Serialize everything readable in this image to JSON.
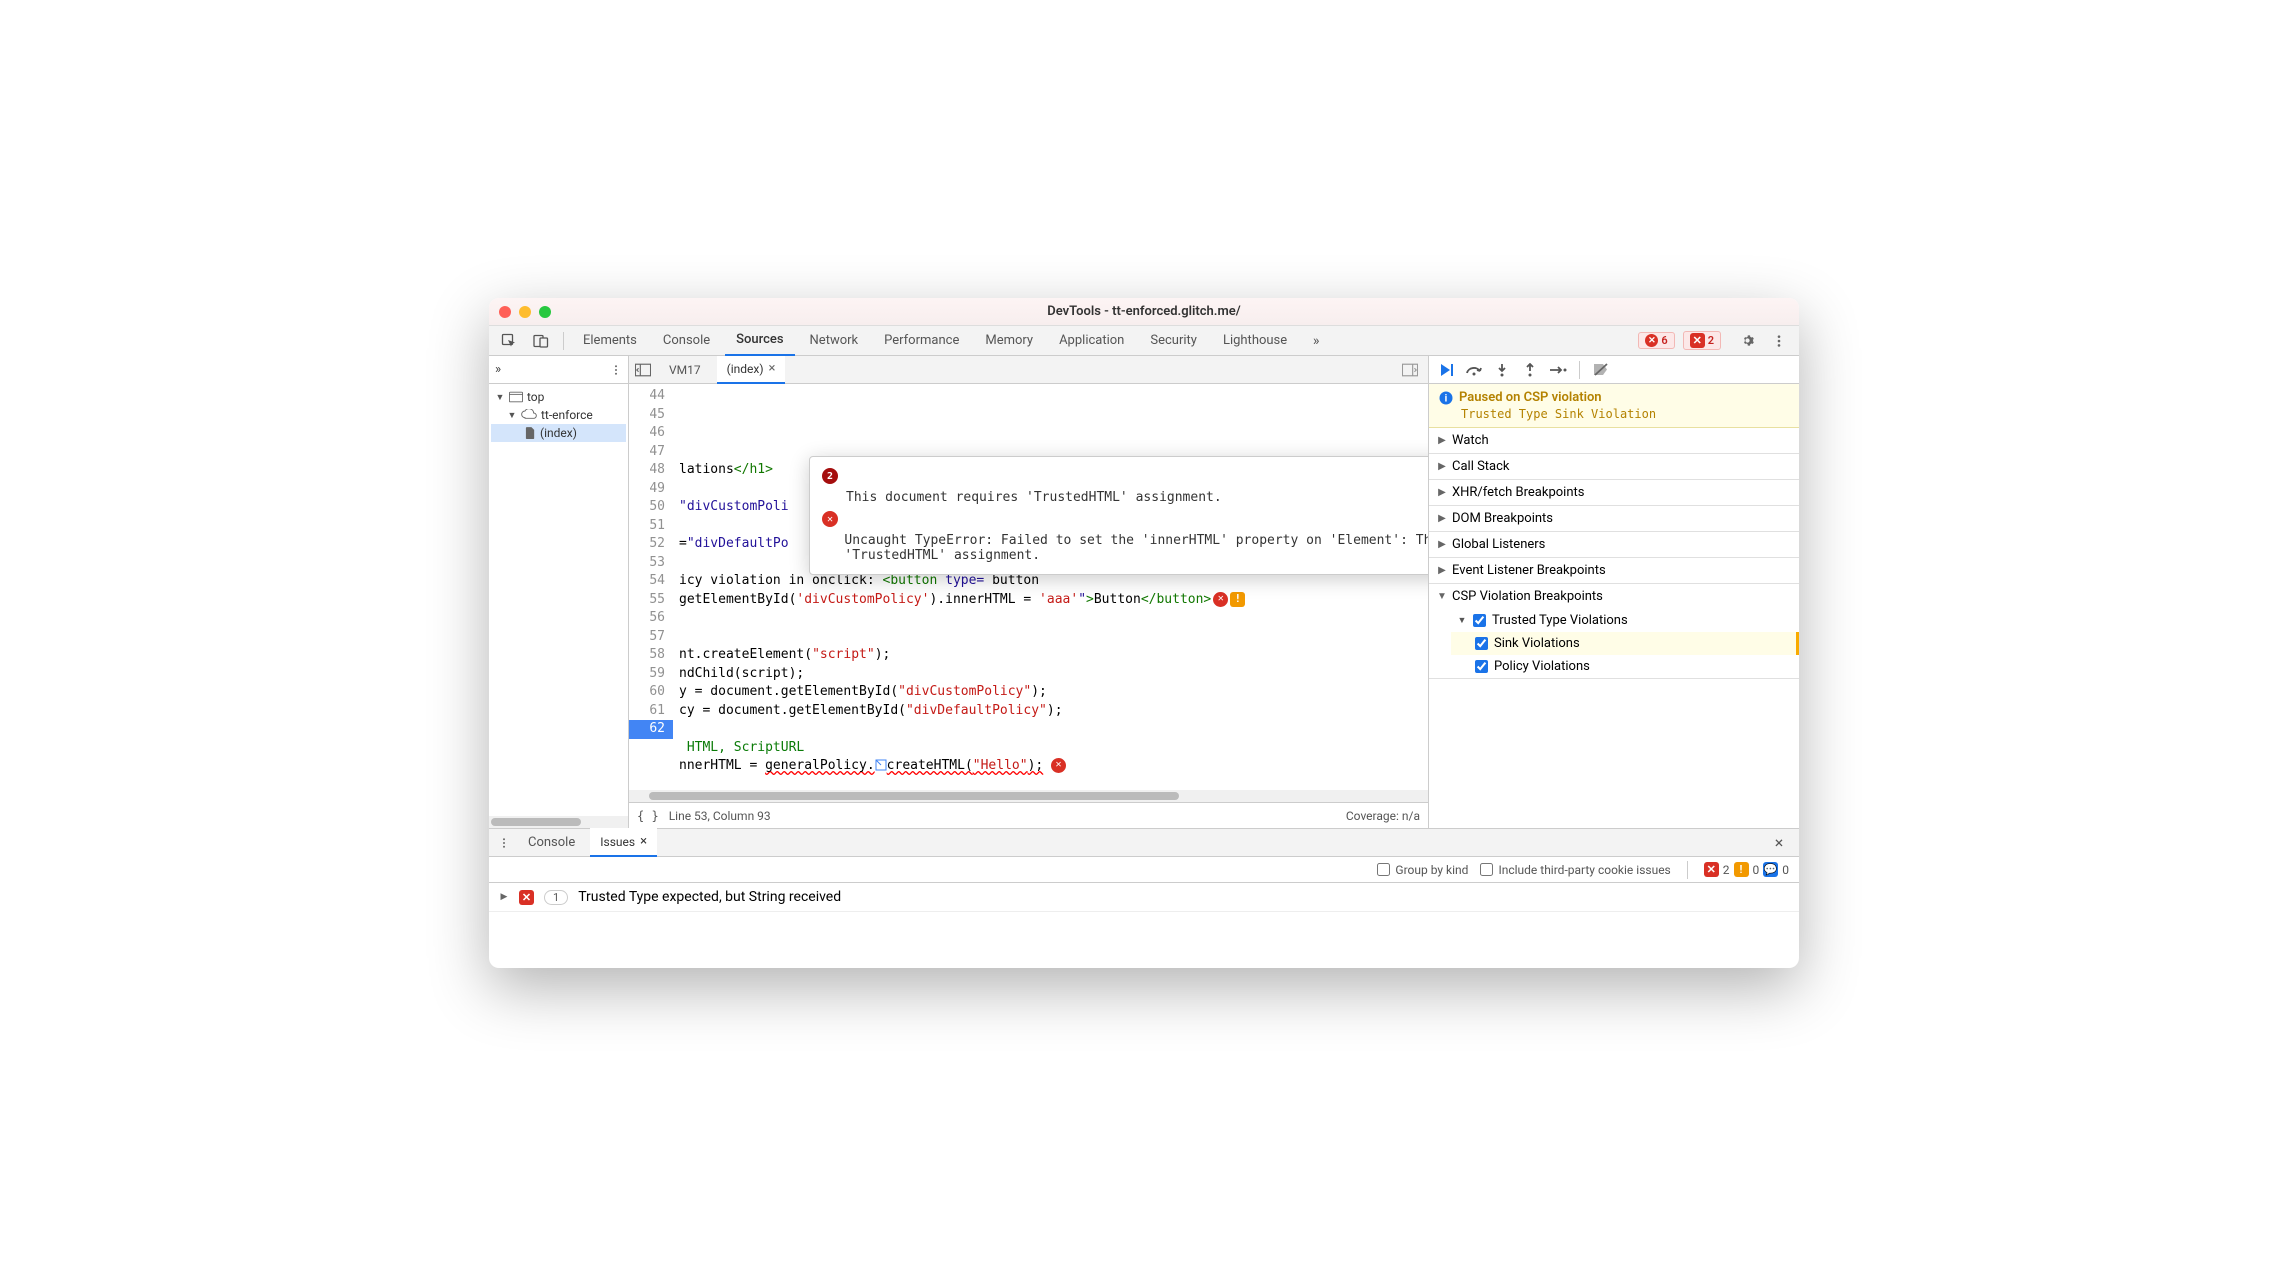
{
  "window": {
    "title": "DevTools - tt-enforced.glitch.me/"
  },
  "tabs": [
    "Elements",
    "Console",
    "Sources",
    "Network",
    "Performance",
    "Memory",
    "Application",
    "Security",
    "Lighthouse"
  ],
  "activeTab": "Sources",
  "errorBadges": {
    "errors": 6,
    "issues": 2
  },
  "leftTree": {
    "top": "top",
    "origin": "tt-enforce",
    "file": "(index)"
  },
  "fileTabs": {
    "vm": "VM17",
    "index": "(index)"
  },
  "gutterStart": 44,
  "code": {
    "l46": "lations</h1>",
    "l48": "\"divCustomPoli",
    "l50": "=\"divDefaultPo",
    "l52": "icy violation in onclick: <button type= button",
    "l53": "getElementById('divCustomPolicy').innerHTML = 'aaa'\">Button</button>",
    "l56": "nt.createElement(\"script\");",
    "l57": "ndChild(script);",
    "l58": "y = document.getElementById(\"divCustomPolicy\");",
    "l59": "cy = document.getElementById(\"divDefaultPolicy\");",
    "l61": " HTML, ScriptURL",
    "l62": "nnerHTML = generalPolicy.createHTML(\"Hello\");"
  },
  "tooltip": {
    "count": "2",
    "msg1": "This document requires 'TrustedHTML' assignment.",
    "msg2": "Uncaught TypeError: Failed to set the 'innerHTML' property on 'Element': This document requires 'TrustedHTML' assignment."
  },
  "status": {
    "pos": "Line 53, Column 93",
    "cov": "Coverage: n/a"
  },
  "pauseBanner": {
    "title": "Paused on CSP violation",
    "sub": "Trusted Type Sink Violation"
  },
  "rightSections": {
    "watch": "Watch",
    "callstack": "Call Stack",
    "xhr": "XHR/fetch Breakpoints",
    "dom": "DOM Breakpoints",
    "global": "Global Listeners",
    "evt": "Event Listener Breakpoints",
    "csp": "CSP Violation Breakpoints",
    "tt": "Trusted Type Violations",
    "sink": "Sink Violations",
    "policy": "Policy Violations"
  },
  "drawer": {
    "console": "Console",
    "issues": "Issues",
    "group": "Group by kind",
    "thirdparty": "Include third-party cookie issues",
    "counts": {
      "err": 2,
      "warn": 0,
      "info": 0
    },
    "issue1": "Trusted Type expected, but String received",
    "issue1_count": "1"
  }
}
